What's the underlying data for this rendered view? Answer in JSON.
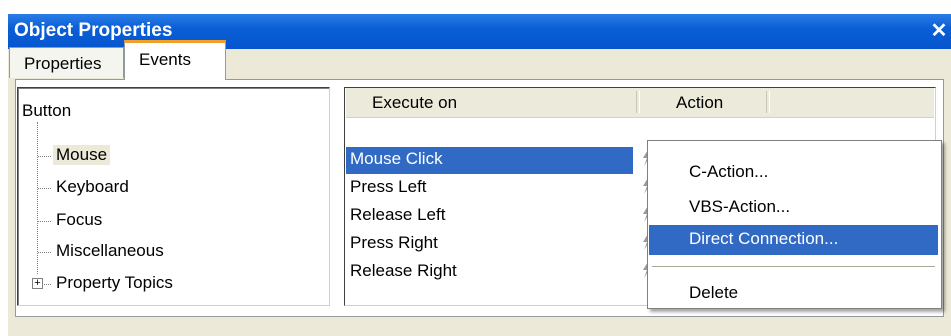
{
  "window": {
    "title": "Object Properties",
    "close_glyph": "✕"
  },
  "tabs": [
    {
      "label": "Properties",
      "active": false
    },
    {
      "label": "Events",
      "active": true
    }
  ],
  "tree": {
    "root": "Button",
    "items": [
      {
        "label": "Mouse",
        "selected": true
      },
      {
        "label": "Keyboard"
      },
      {
        "label": "Focus"
      },
      {
        "label": "Miscellaneous"
      },
      {
        "label": "Property Topics",
        "expandable": true,
        "expander_glyph": "+"
      }
    ]
  },
  "events_list": {
    "columns": [
      "Execute on",
      "Action"
    ],
    "rows": [
      {
        "label": "Mouse Click",
        "selected": true
      },
      {
        "label": "Press Left"
      },
      {
        "label": "Release Left"
      },
      {
        "label": "Press Right"
      },
      {
        "label": "Release Right"
      }
    ],
    "action_icon": "lightning-icon"
  },
  "context_menu": {
    "items": [
      {
        "label": "C-Action..."
      },
      {
        "label": "VBS-Action..."
      },
      {
        "label": "Direct Connection...",
        "highlighted": true
      },
      {
        "label": "Delete"
      }
    ]
  },
  "colors": {
    "titlebar": "#0a5fd6",
    "selection": "#316ac5",
    "window_bg": "#ece9d8",
    "tab_accent": "#f0a028"
  }
}
